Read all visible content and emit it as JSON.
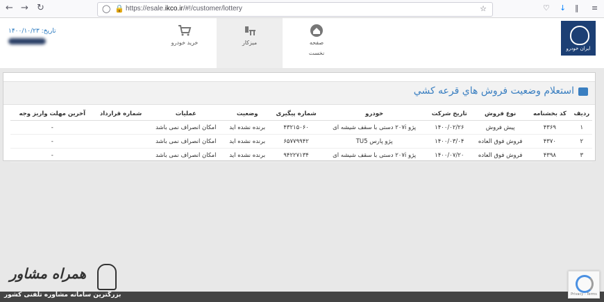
{
  "browser": {
    "url_prefix": "https://esale.",
    "url_domain": "ikco.ir",
    "url_path": "/#!/customer/lottery"
  },
  "header": {
    "date_label": "تاریخ: ۱۴۰۰/۱۰/۲۳",
    "nav": [
      {
        "label": "صفحه",
        "sub": "نخست",
        "icon": "home-icon"
      },
      {
        "label": "میزکار",
        "icon": "desk-icon"
      },
      {
        "label": "خرید خودرو",
        "icon": "cart-icon"
      }
    ]
  },
  "panel": {
    "title": "استعلام وضعيت فروش هاي قرعه كشي"
  },
  "table": {
    "headers": [
      "ردیف",
      "کد بخشنامه",
      "نوع فروش",
      "تاریخ شرکت",
      "خودرو",
      "شماره پیگیری",
      "وضعیت",
      "عملیات",
      "شماره قرارداد",
      "آخرین مهلت واریز وجه"
    ],
    "rows": [
      [
        "۱",
        "۴۳۶۹",
        "پیش فروش",
        "۱۴۰۰/۰۲/۲۶",
        "پژو ۲۰۷i دستی با سقف شیشه ای",
        "۴۳۲۱۵۰۶۰",
        "برنده نشده اید",
        "امکان انصراف نمی باشد",
        "",
        "-"
      ],
      [
        "۲",
        "۴۳۷۰",
        "فروش فوق العاده",
        "۱۴۰۰/۰۳/۰۴",
        "پژو پارس TU5",
        "۶۵۷۷۹۹۴۲",
        "برنده نشده اید",
        "امکان انصراف نمی باشد",
        "",
        "-"
      ],
      [
        "۳",
        "۴۳۹۸",
        "فروش فوق العاده",
        "۱۴۰۰/۰۷/۲۰",
        "پژو ۲۰۷i دستی با سقف شیشه ای",
        "۹۴۲۲۷۱۳۴",
        "برنده نشده اید",
        "امکان انصراف نمی باشد",
        "",
        "-"
      ]
    ]
  },
  "watermark": {
    "brand": "همراه مشاور",
    "tagline": "بزرگترین سامانه مشاوره تلفنی کشور"
  },
  "recaptcha": {
    "links": "Privacy - Terms"
  }
}
